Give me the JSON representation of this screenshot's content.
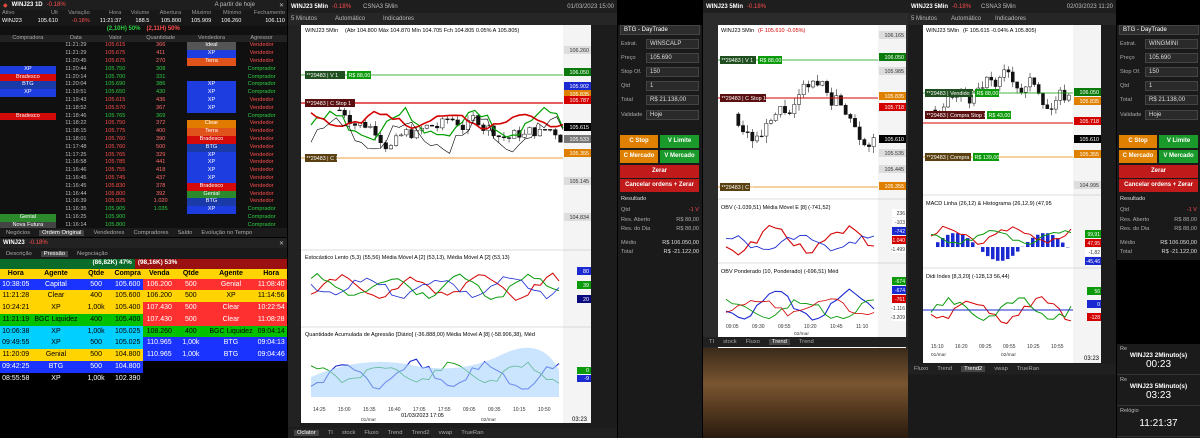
{
  "left": {
    "title": "WINJ23 1D",
    "change": "-0.18%",
    "subtitle": "A partir de hoje",
    "quote_headers": [
      "Ativo",
      "Últ",
      "Variação",
      "Hora",
      "Volume",
      "Abertura",
      "Máximo",
      "Mínimo",
      "Fechamento"
    ],
    "quote": [
      "WINJ23",
      "105.610",
      "-0.18%",
      "11:21:37",
      "188.5",
      "105.800",
      "105.909",
      "106.260",
      "106.110"
    ],
    "depth_left": "(2,10H) 50%",
    "depth_right": "(2,11H) 50%",
    "trade_headers": [
      "Compradora",
      "Data",
      "Valor",
      "Quantidade",
      "Vendedora",
      "Agressor"
    ],
    "trades": [
      [
        "",
        "11:21:29",
        "105.615",
        "366",
        "Ideal",
        "Vendedor"
      ],
      [
        "",
        "11:21:29",
        "105.675",
        "411",
        "XP",
        "Vendedor"
      ],
      [
        "",
        "11:20:45",
        "105.675",
        "270",
        "Terra",
        "Vendedor"
      ],
      [
        "XP",
        "11:20:44",
        "105.750",
        "308",
        "",
        "Comprador"
      ],
      [
        "Bradesco",
        "11:20:14",
        "105.700",
        "331",
        "",
        "Comprador"
      ],
      [
        "BTG",
        "11:20:04",
        "105.690",
        "386",
        "XP",
        "Comprador"
      ],
      [
        "XP",
        "11:19:51",
        "105.650",
        "430",
        "XP",
        "Comprador"
      ],
      [
        "",
        "11:19:43",
        "105.615",
        "436",
        "XP",
        "Vendedor"
      ],
      [
        "",
        "11:18:52",
        "105.570",
        "367",
        "XP",
        "Vendedor"
      ],
      [
        "Bradesco",
        "11:18:46",
        "105.765",
        "369",
        "",
        "Comprador"
      ],
      [
        "",
        "11:18:22",
        "105.750",
        "372",
        "Clear",
        "Vendedor"
      ],
      [
        "",
        "11:18:15",
        "105.775",
        "400",
        "Terra",
        "Vendedor"
      ],
      [
        "",
        "11:18:01",
        "105.760",
        "390",
        "Bradesco",
        "Vendedor"
      ],
      [
        "",
        "11:17:48",
        "105.760",
        "500",
        "BTG",
        "Vendedor"
      ],
      [
        "",
        "11:17:25",
        "105.765",
        "329",
        "XP",
        "Vendedor"
      ],
      [
        "",
        "11:16:58",
        "105.785",
        "441",
        "XP",
        "Vendedor"
      ],
      [
        "",
        "11:16:46",
        "105.755",
        "418",
        "XP",
        "Vendedor"
      ],
      [
        "",
        "11:16:45",
        "105.745",
        "437",
        "XP",
        "Vendedor"
      ],
      [
        "",
        "11:16:45",
        "105.830",
        "378",
        "Bradesco",
        "Vendedor"
      ],
      [
        "",
        "11:16:44",
        "105.800",
        "392",
        "Genial",
        "Vendedor"
      ],
      [
        "",
        "11:16:39",
        "105.925",
        "1.020",
        "BTG",
        "Vendedor"
      ],
      [
        "",
        "11:16:35",
        "105.905",
        "1.035",
        "XP",
        "Comprador"
      ],
      [
        "Genial",
        "11:16:25",
        "105.900",
        "",
        "",
        "Comprador"
      ],
      [
        "Nova Futura",
        "11:16:14",
        "105.800",
        "",
        "",
        "Comprador"
      ]
    ],
    "tabs": [
      "Negócios",
      "Ordem Original",
      "Vendedores",
      "Compradores",
      "Saldo",
      "Evolução no Tempo"
    ],
    "book_title": "WINJ23",
    "book_change": "-0.18%",
    "book_tabs": [
      "Descrição",
      "Pressão",
      "Negociação"
    ],
    "pressure_left": "(86,82K) 47%",
    "pressure_right": "(98,16K) 53%",
    "book_headers": [
      "Hora",
      "Agente",
      "Qtde",
      "Compra",
      "Venda",
      "Qtde",
      "Agente",
      "Hora"
    ],
    "book": [
      [
        "10:38:05",
        "Capital",
        "500",
        "105.600",
        "106.200",
        "500",
        "Genial",
        "11:08:40"
      ],
      [
        "11:21:28",
        "Clear",
        "400",
        "105.600",
        "106.200",
        "500",
        "XP",
        "11:14:56"
      ],
      [
        "10:24:21",
        "XP",
        "1,00k",
        "105.400",
        "107.430",
        "500",
        "Clear",
        "10:22:54"
      ],
      [
        "11:21:19",
        "BGC Liquidez",
        "400",
        "105.400",
        "107.430",
        "500",
        "Clear",
        "11:08:28"
      ],
      [
        "10:06:38",
        "XP",
        "1,00k",
        "105.025",
        "108.260",
        "400",
        "BGC Liquidez",
        "09:04:14"
      ],
      [
        "09:49:55",
        "XP",
        "500",
        "105.025",
        "110.965",
        "1,00k",
        "BTG",
        "09:04:13"
      ],
      [
        "11:20:09",
        "Genial",
        "500",
        "104.800",
        "110.965",
        "1,00k",
        "BTG",
        "09:04:46"
      ],
      [
        "09:42:25",
        "BTG",
        "500",
        "104.800",
        "",
        "",
        "",
        ""
      ],
      [
        "08:55:58",
        "XP",
        "1,00k",
        "102.390",
        "",
        "",
        "",
        ""
      ]
    ]
  },
  "chart1": {
    "window_title": "WINJ23 5Min",
    "change": "-0.18%",
    "tab2": "CSNA3 5Min",
    "datetime": "01/03/2023 15:00",
    "interval": "5 Minutos",
    "mode": "Automático",
    "indicators": "Indicadores",
    "info": "WINJ23 5Min",
    "ohlc": "(Abr 104.800 Máx 104.870 Mín 104.705 Fch 104.805 0.05% A 105.805)",
    "price_scale": [
      "106.260",
      "106.050",
      "105.902",
      "105.835",
      "105.787",
      "105.615",
      "105.533",
      "105.355",
      "105.145",
      "104.834"
    ],
    "current_price": "105.615",
    "order_line1": "**29483 | V 1",
    "order_price1": "R$ 88,00",
    "order_line2": "**29483 | C Stop 1",
    "order_line3": "**29483 | C 1",
    "osc_title": "Estocástico Lento (5,3) (55,56)   Média Móvel A [2] (53,13), Média Móvel A [2] (53,13)",
    "osc_scale": [
      "80",
      "39",
      "20"
    ],
    "agg_title": "Quantidade Acumulada de Agressão [Diário] (-36.888,00)   Média Móvel A [8] (-58.906,38), Méd",
    "agg_scale": [
      "0",
      "-9"
    ],
    "time_labels": [
      "14:25",
      "15:00",
      "15:35",
      "16:40",
      "17:05",
      "17:55",
      "09:05",
      "09:35",
      "10:15",
      "10:50"
    ],
    "date_label": "01/03/2023 17:05",
    "date2": "01/mar",
    "date3": "02/mar",
    "clock": "03:23",
    "bottom_tabs": [
      "Oclator",
      "TI",
      "stock",
      "Fluxo",
      "Trend",
      "Trend2",
      "vwap",
      "TrueRan"
    ]
  },
  "order_panel": {
    "account": "BTG - DayTrade",
    "asset_label": "Estrat.",
    "asset": "WINSCALP",
    "price_label": "Preço",
    "price": "105.690",
    "stop_label": "Stop Of.",
    "stop": "150",
    "qty_label": "Qtd",
    "qty": "1",
    "total_label": "Total",
    "total": "R$ 21.138,00",
    "validity_label": "Validade",
    "validity": "Hoje",
    "btn_cstop": "C Stop",
    "btn_vlimit": "V Limite",
    "btn_cmercado": "C Mercado",
    "btn_vmercado": "V Mercado",
    "btn_zerar": "Zerar",
    "btn_cancel": "Cancelar ordens + Zerar",
    "result_label": "Resultado",
    "qtd_label": "Qtd",
    "qtd": "-1 V",
    "open_label": "Res. Aberto",
    "open": "R$ 88,00",
    "day_label": "Res. do Dia",
    "day": "R$ 88,00",
    "avg_label": "Médio",
    "avg": "R$ 106.050,00",
    "total2_label": "Total",
    "total2": "R$ -21.122,00"
  },
  "chart2": {
    "window_title": "WINJ23 5Min",
    "change": "-0.18%",
    "info": "WINJ23 5Min",
    "ohlc": "(F 105.610 -0.05%)",
    "price_scale": [
      "106.165",
      "106.050",
      "105.985",
      "105.835",
      "105.718",
      "105.610",
      "105.535",
      "105.445",
      "105.355"
    ],
    "order1": "**29483 | V 1",
    "order1_price": "R$ 88,00",
    "order2": "**29483 | C Stop 1",
    "order3": "**29483 | C 1",
    "obv_title": "OBV  (-1.039,51)   Média Móvel E [8] (-741,52)",
    "obv_scale": [
      "236",
      "-103",
      "-742",
      "-1.040",
      "-1.499"
    ],
    "obvp_title": "OBV Ponderado (10, Ponderado) (-696,51)   Méd",
    "obvp_scale": [
      "-674",
      "-674",
      "-761",
      "-1.116",
      "-3.209"
    ],
    "time_labels": [
      "09:05",
      "09:30",
      "09:55",
      "10:20",
      "10:45",
      "11:10"
    ],
    "date2": "02/mar",
    "clock": "03:23",
    "bottom_tabs": [
      "TI",
      "stock",
      "Fluxo",
      "Trend",
      "Trend"
    ]
  },
  "chart3": {
    "window_title": "WINJ23 5Min",
    "change": "-0.18%",
    "tab2": "CSNA3 5Min",
    "datetime": "02/03/2023 11:20",
    "info": "WINJ23 5Min",
    "ohlc": "(F 105.615 -0.04% A 105.805)",
    "interval": "5 Minutos",
    "mode": "Automático",
    "indicators": "Indicadores",
    "price_scale": [
      "106.050",
      "105.835",
      "105.718",
      "105.610",
      "105.355",
      "104.995"
    ],
    "order1": "**29483 | Vendido 1",
    "order1_price": "R$ 88,00",
    "order2": "**29483 | Compra Stop 1",
    "order2_price": "R$ 43,00",
    "order3": "**29483 | Compra 1",
    "order3_price": "R$ 139,00",
    "macd_title": "MACD Linha (26,12) & Histograma (26,12,9) (47,95",
    "macd_scale": [
      "99,91",
      "47,95",
      "-1,82",
      "-45,46"
    ],
    "didi_title": "Didi Index [8,3,20] (-128,13  56,44)",
    "didi_scale": [
      "56",
      "0",
      "-128"
    ],
    "time_labels": [
      "15:10",
      "16:20",
      "09:25",
      "09:55",
      "10:25",
      "10:55"
    ],
    "date1": "01/mar",
    "date2": "02/mar",
    "clock": "03:23",
    "bottom_tabs": [
      "Fluxo",
      "Trend",
      "Trend2",
      "vwap",
      "TrueRan"
    ]
  },
  "order_panel2": {
    "account": "BTG - DayTrade",
    "asset_label": "Estrat.",
    "asset": "WINGMINI",
    "price_label": "Preço",
    "price": "105.690",
    "stop_label": "Stop Of.",
    "stop": "150",
    "qty_label": "Qtd",
    "qty": "1",
    "total_label": "Total",
    "total": "R$ 21.138,00",
    "validity_label": "Validade",
    "validity": "Hoje",
    "btn_cstop": "C Stop",
    "btn_vlimit": "V Limite",
    "btn_cmercado": "C Mercado",
    "btn_vmercado": "V Mercado",
    "btn_zerar": "Zerar",
    "btn_cancel": "Cancelar ordens + Zerar",
    "result_label": "Resultado",
    "qtd_label": "Qtd",
    "qtd": "-1 V",
    "open_label": "Res. Aberto",
    "open": "R$ 88,00",
    "day_label": "Res. do Dia",
    "day": "R$ 88,00",
    "avg_label": "Médio",
    "avg": "R$ 106.050,00",
    "total2_label": "Total",
    "total2": "R$ -21.122,00"
  },
  "timers": [
    {
      "label": "Re",
      "title": "WINJ23 2Minuto(s)",
      "value": "00:23"
    },
    {
      "label": "Re",
      "title": "WINJ23 5Minuto(s)",
      "value": "03:23"
    },
    {
      "label": "Relógio",
      "title": "",
      "value": "11:21:37"
    }
  ],
  "colors": {
    "neg": "#ff4d4d",
    "pos": "#2ecc40",
    "bg": "#000000",
    "panel": "#1a1a1a"
  }
}
